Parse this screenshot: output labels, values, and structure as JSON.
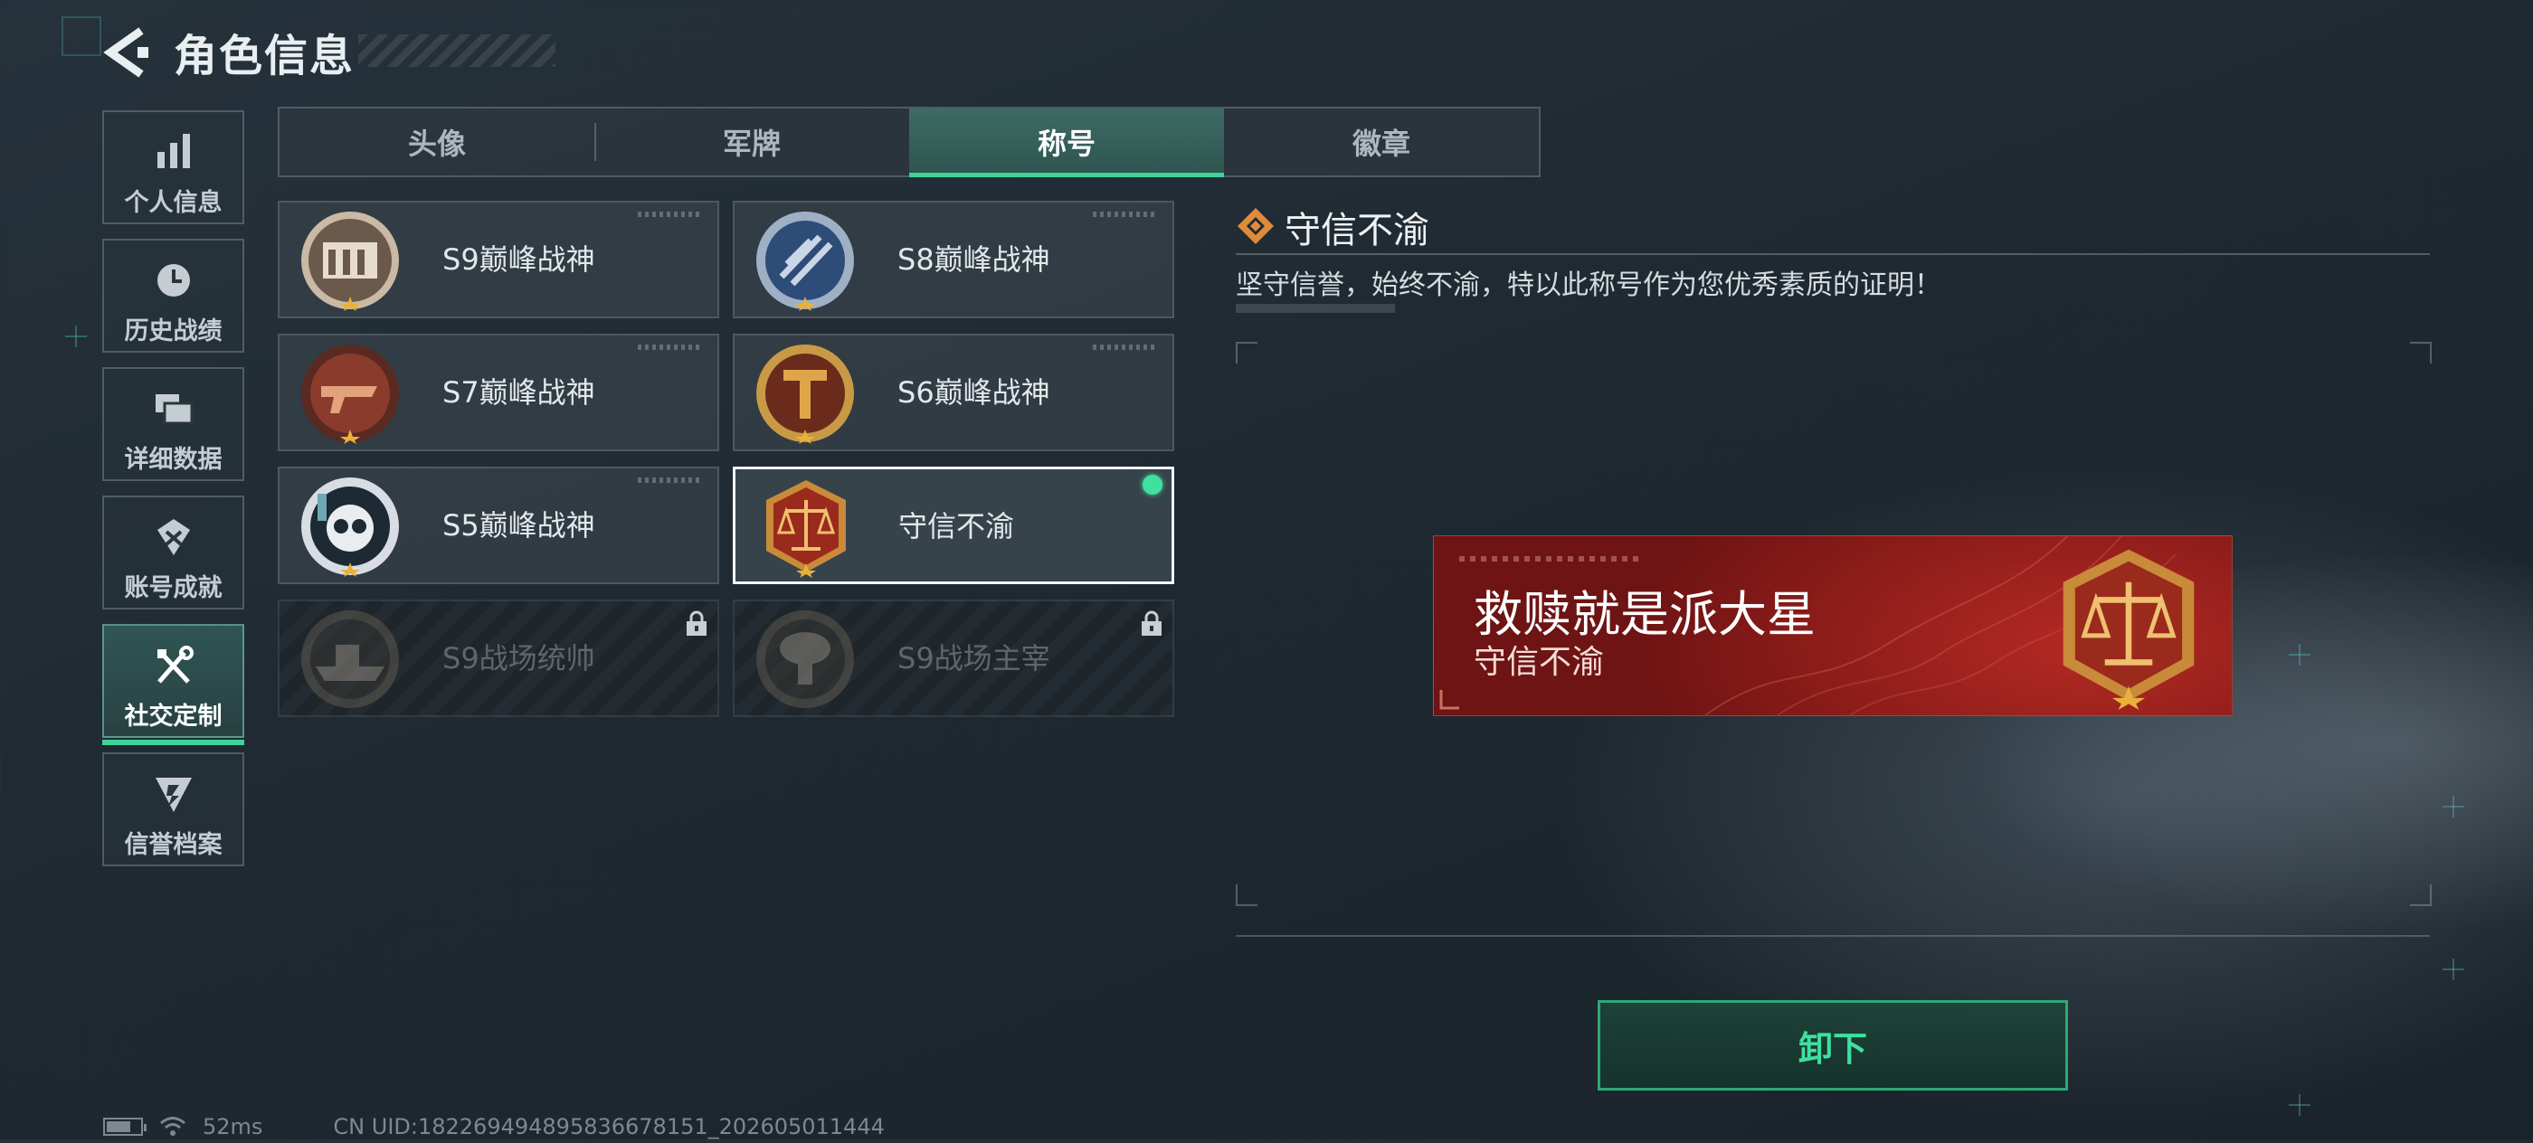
{
  "header": {
    "title": "角色信息"
  },
  "sidebar": {
    "items": [
      {
        "label": "个人信息",
        "icon": "bar-chart-icon"
      },
      {
        "label": "历史战绩",
        "icon": "clock-icon"
      },
      {
        "label": "详细数据",
        "icon": "folder-icon"
      },
      {
        "label": "账号成就",
        "icon": "achievement-icon"
      },
      {
        "label": "社交定制",
        "icon": "tools-icon",
        "active": true
      },
      {
        "label": "信誉档案",
        "icon": "reputation-icon"
      }
    ]
  },
  "tabs": [
    {
      "label": "头像"
    },
    {
      "label": "军牌"
    },
    {
      "label": "称号",
      "active": true
    },
    {
      "label": "徽章"
    }
  ],
  "titles": [
    {
      "name": "S9巅峰战神",
      "icon": "s9-peak-badge-icon"
    },
    {
      "name": "S8巅峰战神",
      "icon": "s8-peak-badge-icon"
    },
    {
      "name": "S7巅峰战神",
      "icon": "s7-peak-badge-icon"
    },
    {
      "name": "S6巅峰战神",
      "icon": "s6-peak-badge-icon"
    },
    {
      "name": "S5巅峰战神",
      "icon": "s5-peak-badge-icon"
    },
    {
      "name": "守信不渝",
      "icon": "scales-badge-icon",
      "selected": true,
      "equipped": true
    },
    {
      "name": "S9战场统帅",
      "icon": "warship-badge-icon",
      "locked": true
    },
    {
      "name": "S9战场主宰",
      "icon": "mushroom-cloud-badge-icon",
      "locked": true
    }
  ],
  "detail": {
    "title": "守信不渝",
    "description": "坚守信誉，始终不渝，特以此称号作为您优秀素质的证明！"
  },
  "preview": {
    "player_name": "救赎就是派大星",
    "title": "守信不渝"
  },
  "actions": {
    "unequip_label": "卸下"
  },
  "status": {
    "ping": "52ms",
    "uid": "CN UID:18226949489583667815​1_202605011444"
  },
  "colors": {
    "accent": "#3fd39a",
    "banner_red": "#a8231f",
    "badge_gold": "#d9a441"
  }
}
